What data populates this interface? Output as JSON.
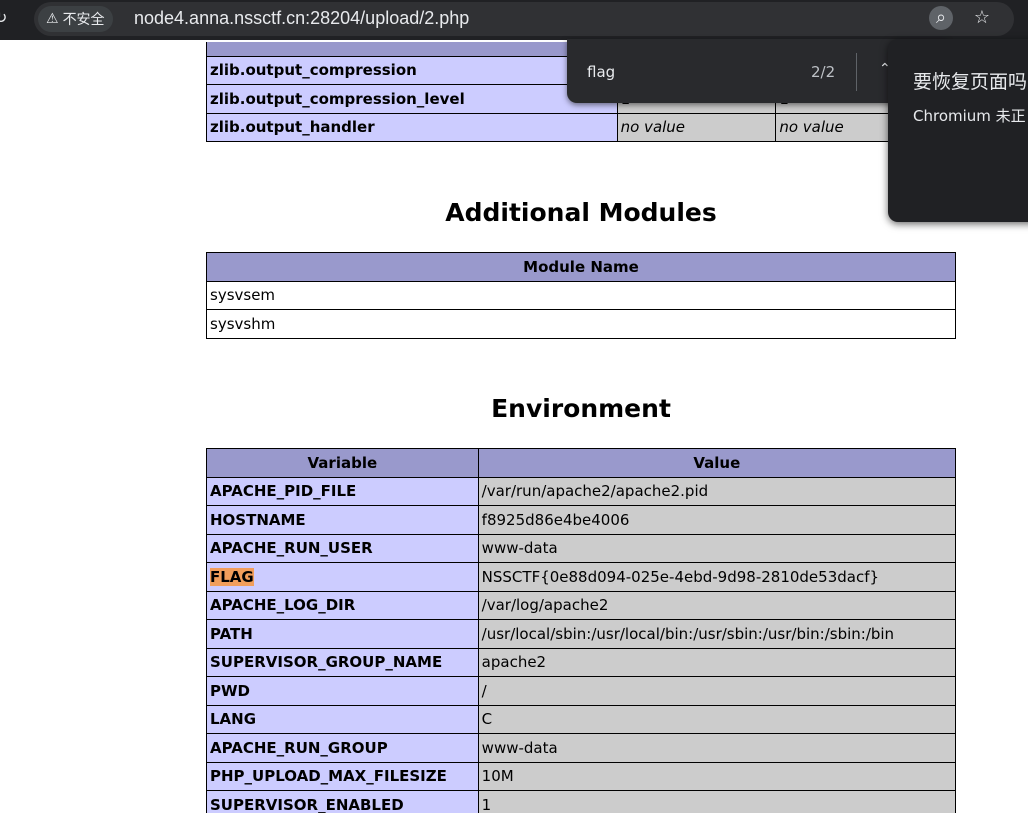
{
  "browser": {
    "security_label": "不安全",
    "url": "node4.anna.nssctf.cn:28204/upload/2.php"
  },
  "zlib_table": {
    "rows": [
      {
        "name": "zlib.output_compression",
        "local": "",
        "master": ""
      },
      {
        "name": "zlib.output_compression_level",
        "local": "1",
        "master": "1"
      },
      {
        "name": "zlib.output_handler",
        "local": "no value",
        "master": "no value"
      }
    ]
  },
  "additional_modules": {
    "title": "Additional Modules",
    "header": "Module Name",
    "modules": [
      "sysvsem",
      "sysvshm"
    ]
  },
  "environment": {
    "title": "Environment",
    "headers": [
      "Variable",
      "Value"
    ],
    "rows": [
      {
        "var": "APACHE_PID_FILE",
        "value": "/var/run/apache2/apache2.pid"
      },
      {
        "var": "HOSTNAME",
        "value": "f8925d86e4be4006"
      },
      {
        "var": "APACHE_RUN_USER",
        "value": "www-data"
      },
      {
        "var": "FLAG",
        "value": "NSSCTF{0e88d094-025e-4ebd-9d98-2810de53dacf}"
      },
      {
        "var": "APACHE_LOG_DIR",
        "value": "/var/log/apache2"
      },
      {
        "var": "PATH",
        "value": "/usr/local/sbin:/usr/local/bin:/usr/sbin:/usr/bin:/sbin:/bin"
      },
      {
        "var": "SUPERVISOR_GROUP_NAME",
        "value": "apache2"
      },
      {
        "var": "PWD",
        "value": "/"
      },
      {
        "var": "LANG",
        "value": "C"
      },
      {
        "var": "APACHE_RUN_GROUP",
        "value": "www-data"
      },
      {
        "var": "PHP_UPLOAD_MAX_FILESIZE",
        "value": "10M"
      },
      {
        "var": "SUPERVISOR_ENABLED",
        "value": "1"
      }
    ]
  },
  "find_bar": {
    "query": "flag",
    "count": "2/2"
  },
  "restore_popup": {
    "title": "要恢复页面吗",
    "body": "Chromium 未正"
  },
  "colors": {
    "row_label_bg": "#ccccff",
    "value_bg": "#cccccc",
    "header_bg": "#9999cc",
    "find_highlight": "#f19e5b"
  }
}
